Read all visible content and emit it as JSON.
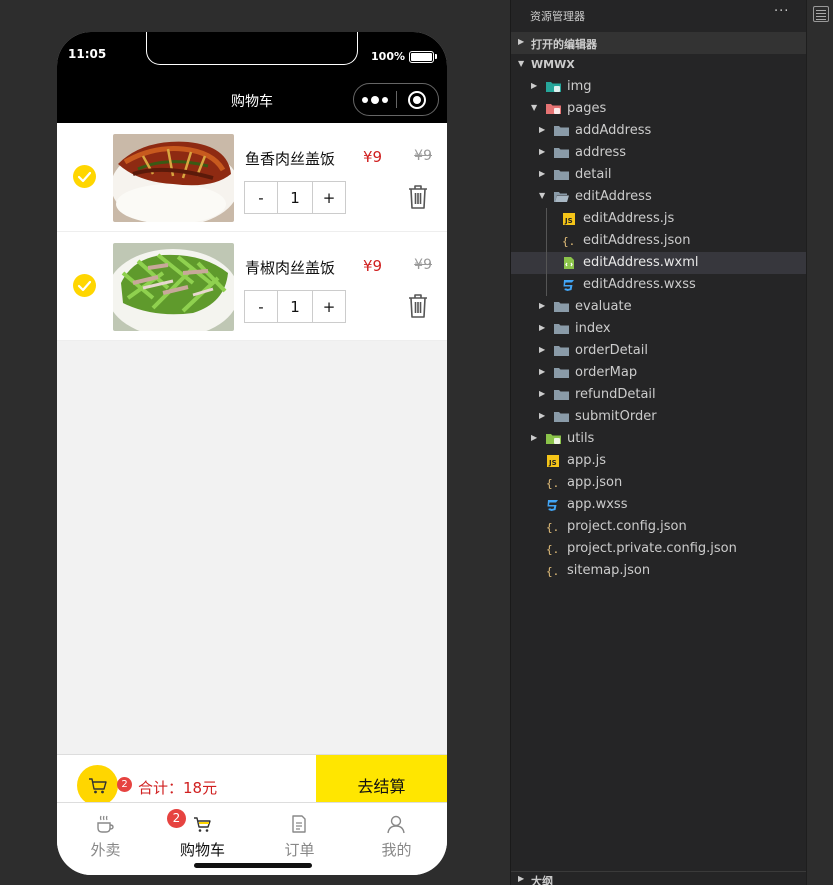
{
  "phone": {
    "time": "11:05",
    "battery": "100%",
    "nav_title": "购物车"
  },
  "cart": {
    "items": [
      {
        "name": "鱼香肉丝盖饭",
        "price": "¥9",
        "original_price": "¥9",
        "quantity": "1",
        "minus": "-",
        "plus": "+",
        "image": "yuxiang-rousi-dish"
      },
      {
        "name": "青椒肉丝盖饭",
        "price": "¥9",
        "original_price": "¥9",
        "quantity": "1",
        "minus": "-",
        "plus": "+",
        "image": "qingjiao-rousi-dish"
      }
    ],
    "badge_count": "2",
    "total_label": "合计：18元",
    "checkout_label": "去结算"
  },
  "tabbar": {
    "tabs": [
      {
        "label": "外卖",
        "icon": "coffee-cup-icon",
        "active": false
      },
      {
        "label": "购物车",
        "icon": "cart-icon",
        "active": true,
        "badge": "2"
      },
      {
        "label": "订单",
        "icon": "order-doc-icon",
        "active": false
      },
      {
        "label": "我的",
        "icon": "user-icon",
        "active": false
      }
    ]
  },
  "explorer": {
    "title": "资源管理器",
    "more": "···",
    "open_editors": "打开的编辑器",
    "project": "WMWX",
    "tree": [
      {
        "label": "img",
        "type": "folder-special",
        "color": "#26a69a"
      },
      {
        "label": "pages",
        "type": "folder-special",
        "color": "#e57373"
      },
      {
        "label": "addAddress",
        "type": "folder"
      },
      {
        "label": "address",
        "type": "folder"
      },
      {
        "label": "detail",
        "type": "folder"
      },
      {
        "label": "editAddress",
        "type": "folder-open"
      },
      {
        "label": "editAddress.js",
        "type": "js"
      },
      {
        "label": "editAddress.json",
        "type": "json"
      },
      {
        "label": "editAddress.wxml",
        "type": "wxml"
      },
      {
        "label": "editAddress.wxss",
        "type": "wxss"
      },
      {
        "label": "evaluate",
        "type": "folder"
      },
      {
        "label": "index",
        "type": "folder"
      },
      {
        "label": "orderDetail",
        "type": "folder"
      },
      {
        "label": "orderMap",
        "type": "folder"
      },
      {
        "label": "refundDetail",
        "type": "folder"
      },
      {
        "label": "submitOrder",
        "type": "folder"
      },
      {
        "label": "utils",
        "type": "folder-special",
        "color": "#8bc34a"
      },
      {
        "label": "app.js",
        "type": "js"
      },
      {
        "label": "app.json",
        "type": "json"
      },
      {
        "label": "app.wxss",
        "type": "wxss"
      },
      {
        "label": "project.config.json",
        "type": "json"
      },
      {
        "label": "project.private.config.json",
        "type": "json"
      },
      {
        "label": "sitemap.json",
        "type": "json"
      }
    ],
    "outline": "大纲"
  },
  "colors": {
    "accent_yellow": "#ffd600",
    "checkout_yellow": "#ffe600",
    "price_red": "#d02020",
    "badge_red": "#e64340"
  }
}
